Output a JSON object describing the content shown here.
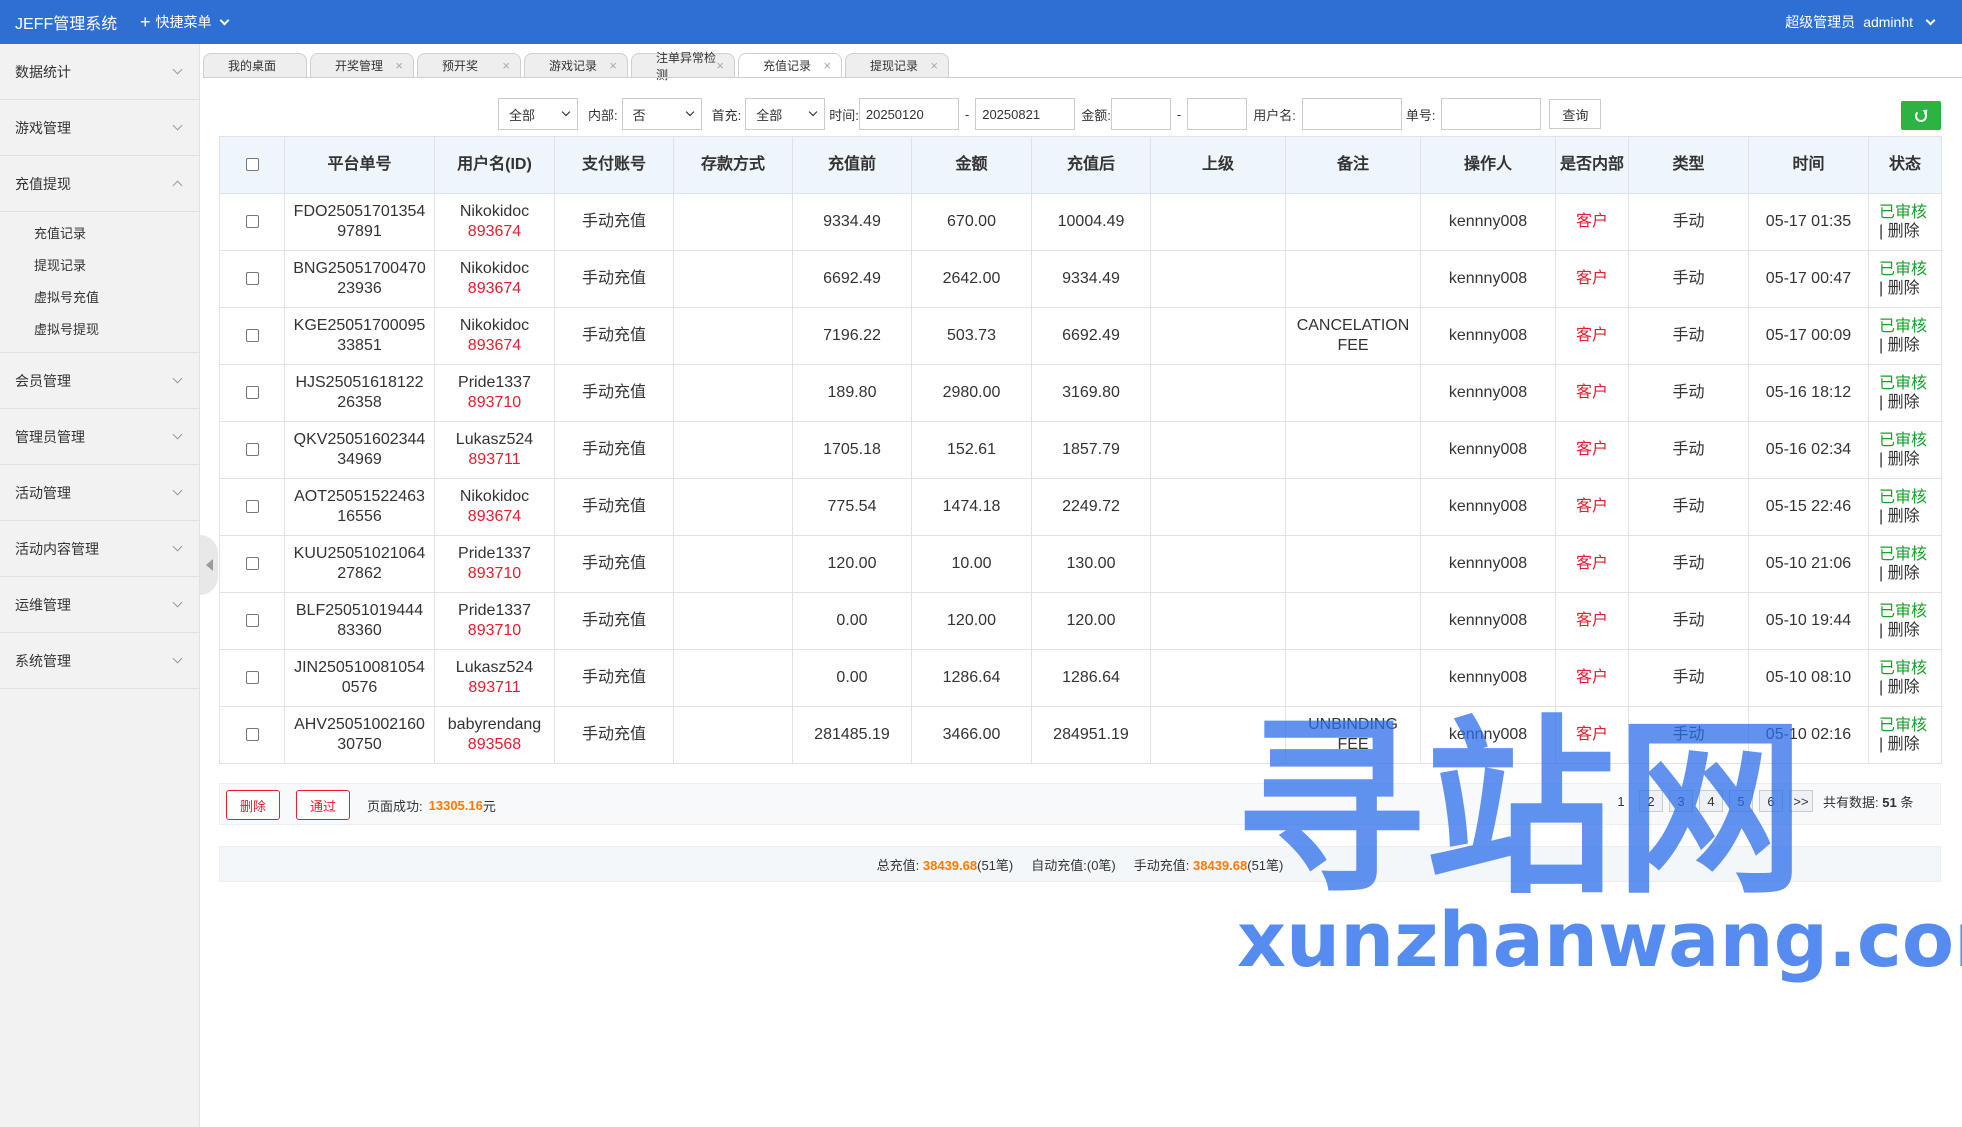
{
  "header": {
    "brand": "JEFF管理系统",
    "quick_menu": "快捷菜单",
    "role": "超级管理员",
    "username": "adminht"
  },
  "sidebar": {
    "items": [
      {
        "label": "数据统计"
      },
      {
        "label": "游戏管理"
      },
      {
        "label": "充值提现"
      },
      {
        "label": "会员管理"
      },
      {
        "label": "管理员管理"
      },
      {
        "label": "活动管理"
      },
      {
        "label": "活动内容管理"
      },
      {
        "label": "运维管理"
      },
      {
        "label": "系统管理"
      }
    ],
    "submenu": [
      "充值记录",
      "提现记录",
      "虚拟号充值",
      "虚拟号提现"
    ]
  },
  "tabs": [
    "我的桌面",
    "开奖管理",
    "预开奖",
    "游戏记录",
    "注单异常检测",
    "充值记录",
    "提现记录"
  ],
  "filters": {
    "type_select": "全部",
    "internal_label": "内部:",
    "internal_select": "否",
    "first_label": "首充:",
    "first_select": "全部",
    "time_label": "时间:",
    "date_from": "20250120",
    "date_to": "20250821",
    "amount_label": "金额:",
    "amount_from": "",
    "amount_to": "",
    "dash": "-",
    "username_label": "用户名:",
    "username_value": "",
    "order_label": "单号:",
    "order_value": "",
    "query_button": "查询"
  },
  "table": {
    "headers": [
      "平台单号",
      "用户名(ID)",
      "支付账号",
      "存款方式",
      "充值前",
      "金额",
      "充值后",
      "上级",
      "备注",
      "操作人",
      "是否内部",
      "类型",
      "时间",
      "状态"
    ],
    "rows": [
      {
        "order": "FDO2505170135497891",
        "user": "Nikokidoc",
        "uid": "893674",
        "account": "手动充值",
        "method": "",
        "before": "9334.49",
        "amount": "670.00",
        "after": "10004.49",
        "parent": "",
        "note": "",
        "operator": "kennny008",
        "internal": "客户",
        "type": "手动",
        "time": "05-17 01:35",
        "status": "已审核",
        "action": "| 删除"
      },
      {
        "order": "BNG2505170047023936",
        "user": "Nikokidoc",
        "uid": "893674",
        "account": "手动充值",
        "method": "",
        "before": "6692.49",
        "amount": "2642.00",
        "after": "9334.49",
        "parent": "",
        "note": "",
        "operator": "kennny008",
        "internal": "客户",
        "type": "手动",
        "time": "05-17 00:47",
        "status": "已审核",
        "action": "| 删除"
      },
      {
        "order": "KGE2505170009533851",
        "user": "Nikokidoc",
        "uid": "893674",
        "account": "手动充值",
        "method": "",
        "before": "7196.22",
        "amount": "503.73",
        "after": "6692.49",
        "parent": "",
        "note": "CANCELATION FEE",
        "operator": "kennny008",
        "internal": "客户",
        "type": "手动",
        "time": "05-17 00:09",
        "status": "已审核",
        "action": "| 删除"
      },
      {
        "order": "HJS2505161812226358",
        "user": "Pride1337",
        "uid": "893710",
        "account": "手动充值",
        "method": "",
        "before": "189.80",
        "amount": "2980.00",
        "after": "3169.80",
        "parent": "",
        "note": "",
        "operator": "kennny008",
        "internal": "客户",
        "type": "手动",
        "time": "05-16 18:12",
        "status": "已审核",
        "action": "| 删除"
      },
      {
        "order": "QKV2505160234434969",
        "user": "Lukasz524",
        "uid": "893711",
        "account": "手动充值",
        "method": "",
        "before": "1705.18",
        "amount": "152.61",
        "after": "1857.79",
        "parent": "",
        "note": "",
        "operator": "kennny008",
        "internal": "客户",
        "type": "手动",
        "time": "05-16 02:34",
        "status": "已审核",
        "action": "| 删除"
      },
      {
        "order": "AOT2505152246316556",
        "user": "Nikokidoc",
        "uid": "893674",
        "account": "手动充值",
        "method": "",
        "before": "775.54",
        "amount": "1474.18",
        "after": "2249.72",
        "parent": "",
        "note": "",
        "operator": "kennny008",
        "internal": "客户",
        "type": "手动",
        "time": "05-15 22:46",
        "status": "已审核",
        "action": "| 删除"
      },
      {
        "order": "KUU2505102106427862",
        "user": "Pride1337",
        "uid": "893710",
        "account": "手动充值",
        "method": "",
        "before": "120.00",
        "amount": "10.00",
        "after": "130.00",
        "parent": "",
        "note": "",
        "operator": "kennny008",
        "internal": "客户",
        "type": "手动",
        "time": "05-10 21:06",
        "status": "已审核",
        "action": "| 删除"
      },
      {
        "order": "BLF2505101944483360",
        "user": "Pride1337",
        "uid": "893710",
        "account": "手动充值",
        "method": "",
        "before": "0.00",
        "amount": "120.00",
        "after": "120.00",
        "parent": "",
        "note": "",
        "operator": "kennny008",
        "internal": "客户",
        "type": "手动",
        "time": "05-10 19:44",
        "status": "已审核",
        "action": "| 删除"
      },
      {
        "order": "JIN2505100810540576",
        "user": "Lukasz524",
        "uid": "893711",
        "account": "手动充值",
        "method": "",
        "before": "0.00",
        "amount": "1286.64",
        "after": "1286.64",
        "parent": "",
        "note": "",
        "operator": "kennny008",
        "internal": "客户",
        "type": "手动",
        "time": "05-10 08:10",
        "status": "已审核",
        "action": "| 删除"
      },
      {
        "order": "AHV2505100216030750",
        "user": "babyrendang",
        "uid": "893568",
        "account": "手动充值",
        "method": "",
        "before": "281485.19",
        "amount": "3466.00",
        "after": "284951.19",
        "parent": "",
        "note": "UNBINDING FEE",
        "operator": "kennny008",
        "internal": "客户",
        "type": "手动",
        "time": "05-10 02:16",
        "status": "已审核",
        "action": "| 删除"
      }
    ]
  },
  "footer": {
    "delete_button": "删除",
    "pass_button": "通过",
    "page_success_label": "页面成功:",
    "page_success_value": "13305.16",
    "page_success_unit": "元",
    "pages": [
      "1",
      "2",
      "3",
      "4",
      "5",
      "6",
      ">>"
    ],
    "total_label": "共有数据:",
    "total_value": "51",
    "total_unit": "条",
    "sum_total_label": "总充值:",
    "sum_total_value": "38439.68",
    "sum_total_count": "(51笔)",
    "auto_label": "自动充值:",
    "auto_count": "(0笔)",
    "manual_label": "手动充值:",
    "manual_value": "38439.68",
    "manual_count": "(51笔)"
  },
  "watermark": {
    "cn": "寻站网",
    "en": "xunzhanwang.com"
  },
  "colors": {
    "header_bg": "#2d6fd2",
    "approved": "#17a12a",
    "customer": "#e0202e",
    "highlight": "#ff7800",
    "refresh": "#2cb443"
  },
  "icons": {
    "refresh": "refresh-icon",
    "plus": "plus-icon",
    "close": "close-icon",
    "chevron": "chevron-down-icon"
  }
}
